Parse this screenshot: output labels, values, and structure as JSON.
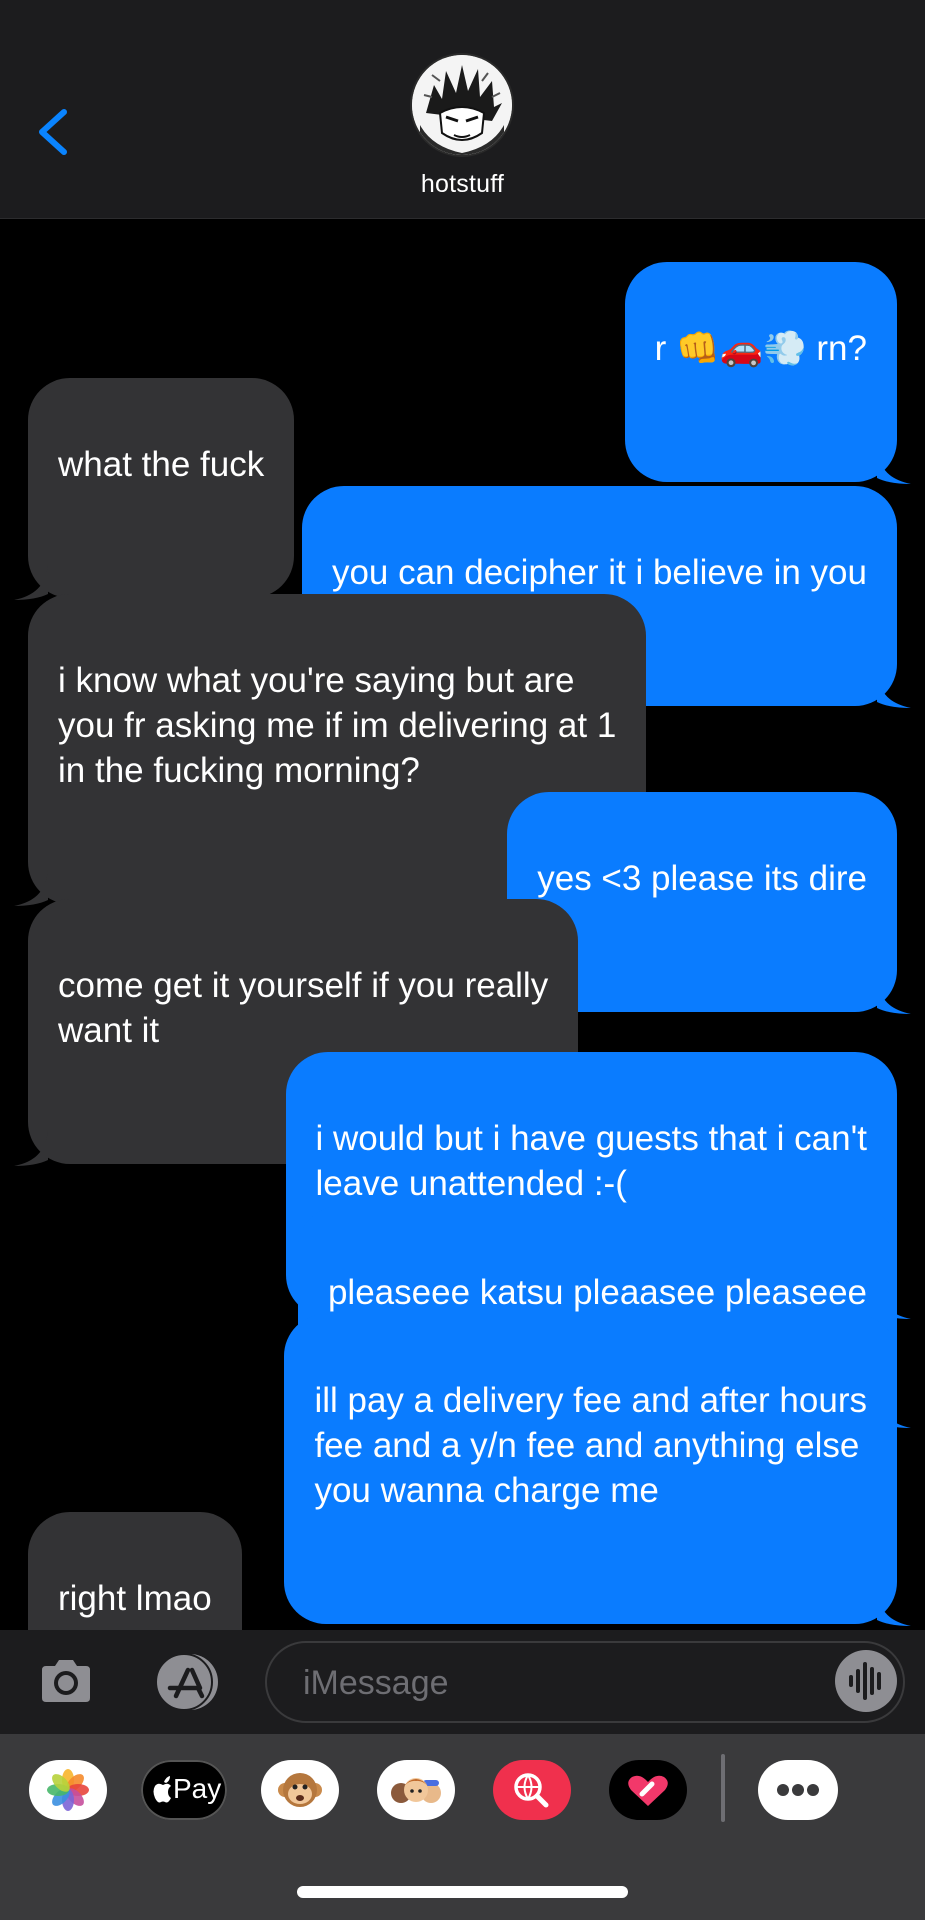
{
  "header": {
    "contact_name": "hotstuff"
  },
  "messages": [
    {
      "side": "sent",
      "text": "r 👊🚗💨 rn?"
    },
    {
      "side": "received",
      "text": "what the fuck"
    },
    {
      "side": "sent",
      "text": "you can decipher it i believe in you"
    },
    {
      "side": "received",
      "text": "i know what you're saying but are\nyou fr asking me if im delivering at 1\nin the fucking morning?"
    },
    {
      "side": "sent",
      "text": "yes <3 please its dire"
    },
    {
      "side": "received",
      "text": "come get it yourself if you really\nwant it"
    },
    {
      "side": "sent",
      "text": "i would but i have guests that i can't\nleave unattended :-("
    },
    {
      "side": "sent",
      "text": "pleaseee katsu pleaasee pleaseee"
    },
    {
      "side": "sent",
      "text": "ill pay a delivery fee and after hours\nfee and a y/n fee and anything else\nyou wanna charge me"
    },
    {
      "side": "received",
      "text": "right lmao"
    }
  ],
  "input": {
    "placeholder": "iMessage",
    "value": ""
  },
  "app_drawer": {
    "apple_pay_label": "Pay",
    "apps": [
      "photos-icon",
      "apple-pay-icon",
      "animoji-icon",
      "memoji-icon",
      "web-search-icon",
      "digital-touch-icon",
      "more-icon"
    ]
  },
  "colors": {
    "sent_bubble": "#0a7cff",
    "received_bubble": "#333335",
    "accent": "#0a84ff",
    "background": "#000000",
    "bar": "#1c1c1e"
  }
}
